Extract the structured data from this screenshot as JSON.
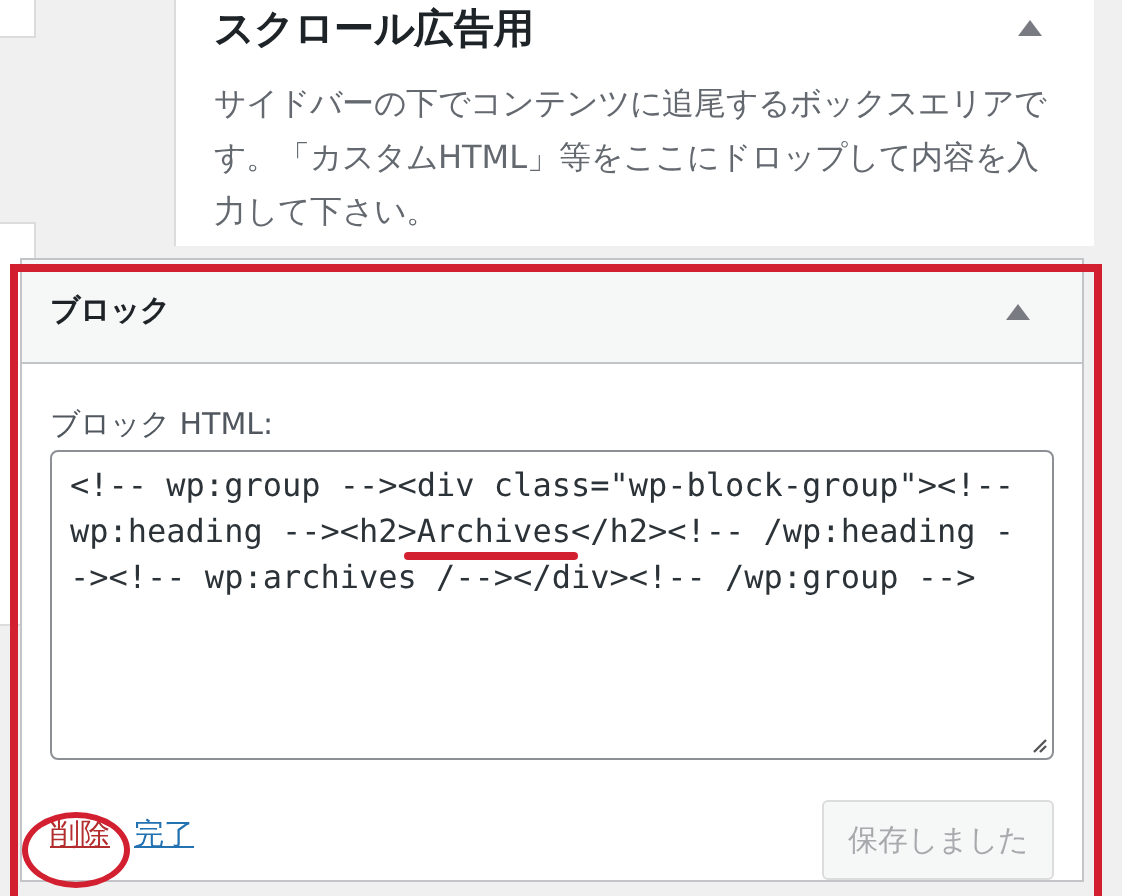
{
  "sidebar_area": {
    "title": "スクロール広告用",
    "expanded": true,
    "description": "サイドバーの下でコンテンツに追尾するボックスエリアです。「カスタムHTML」等をここにドロップして内容を入力して下さい。"
  },
  "widget": {
    "title": "ブロック",
    "expanded": true,
    "field": {
      "label": "ブロック HTML:",
      "value_lines": [
        "<!-- wp:group --><div class=\"wp-block-group\"><!--",
        "wp:heading --><h2>Archives</h2><!-- /wp:heading -",
        "-><!-- wp:archives /--></div><!-- /wp:group -->"
      ]
    },
    "delete_link": "削除",
    "done_link": "完了",
    "save_button": {
      "label": "保存しました",
      "disabled": true
    }
  }
}
